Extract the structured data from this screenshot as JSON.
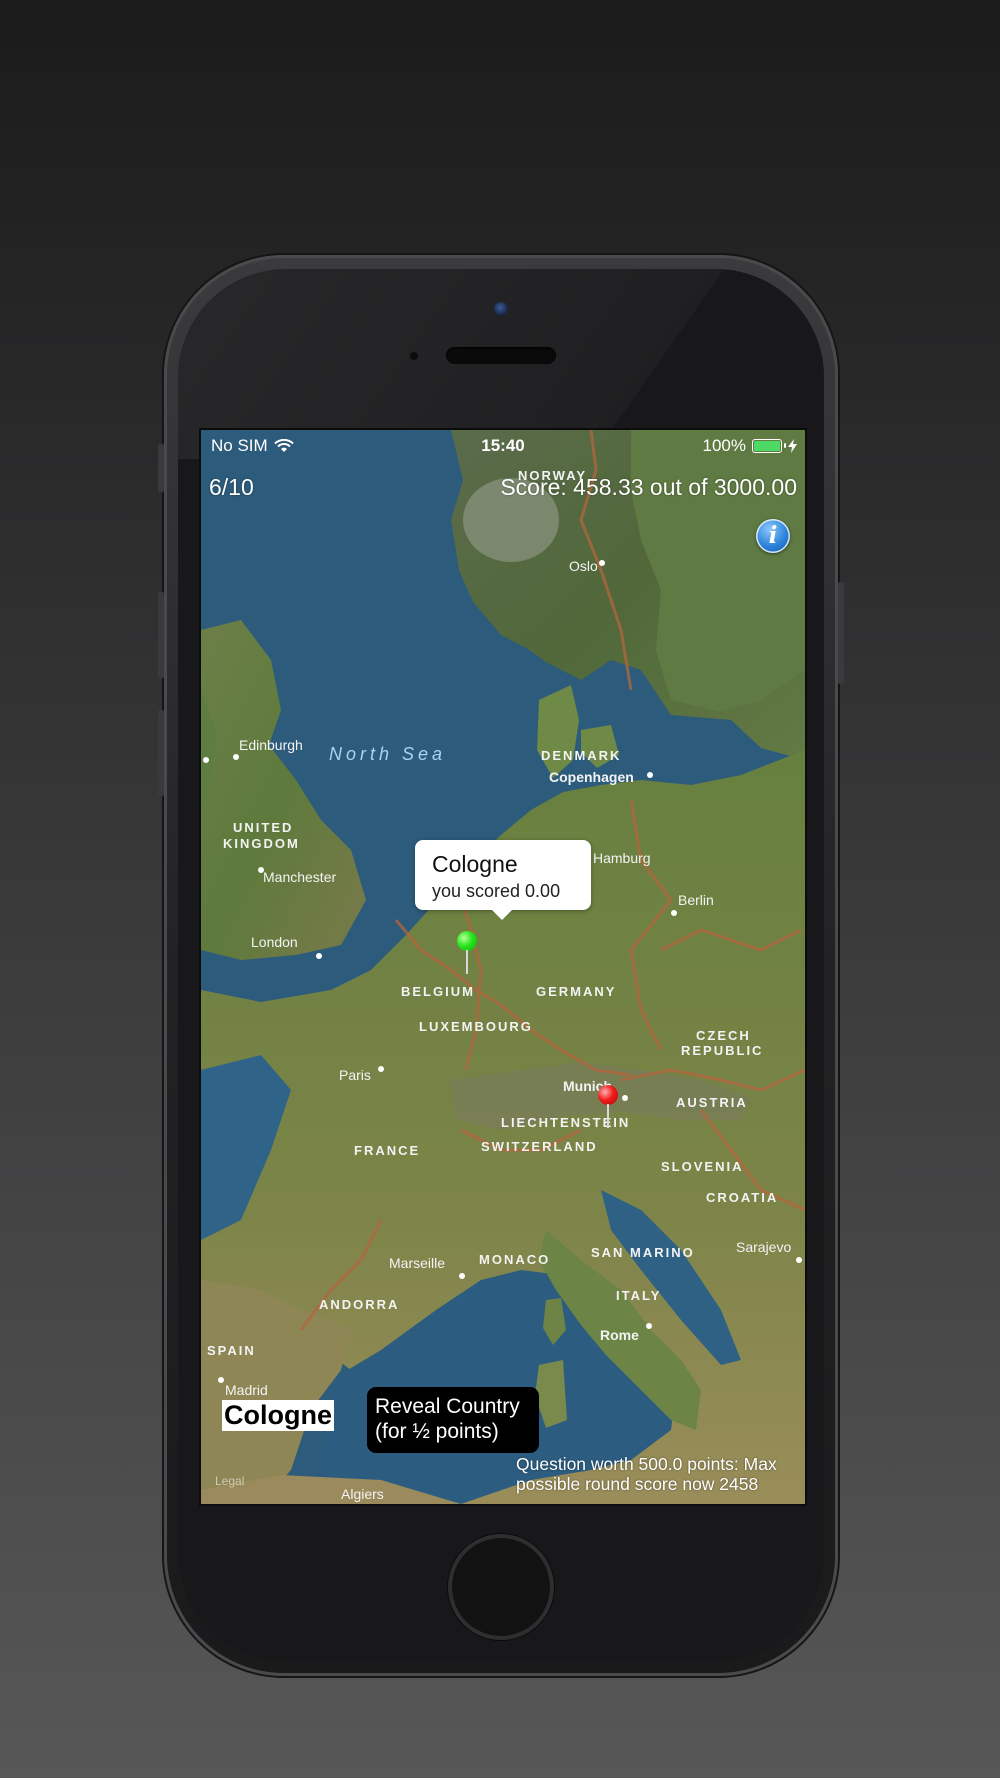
{
  "status_bar": {
    "carrier": "No SIM",
    "time": "15:40",
    "battery_percent": "100%",
    "battery_level": 1.0
  },
  "header": {
    "progress": "6/10",
    "score": "Score: 458.33 out of 3000.00"
  },
  "callout": {
    "title": "Cologne",
    "subtitle": "you scored 0.00"
  },
  "target_city": "Cologne",
  "reveal_button": {
    "line1": "Reveal Country",
    "line2": "(for ½ points)"
  },
  "note": "Question worth 500.0 points: Max possible round score now 2458",
  "legal": "Legal",
  "map_labels": {
    "countries": {
      "norway": "NORWAY",
      "denmark": "DENMARK",
      "uk1": "UNITED",
      "uk2": "KINGDOM",
      "belgium": "BELGIUM",
      "germany": "GERMANY",
      "luxembourg": "LUXEMBOURG",
      "czech1": "CZECH",
      "czech2": "REPUBLIC",
      "austria": "AUSTRIA",
      "liechtenstein": "LIECHTENSTEIN",
      "switzerland": "SWITZERLAND",
      "france": "FRANCE",
      "slovenia": "SLOVENIA",
      "croatia": "CROATIA",
      "monaco": "MONACO",
      "san_marino": "SAN MARINO",
      "andorra": "ANDORRA",
      "italy": "ITALY",
      "spain": "SPAIN"
    },
    "cities": {
      "oslo": "Oslo",
      "edinburgh": "Edinburgh",
      "copenhagen": "Copenhagen",
      "manchester": "Manchester",
      "hamburg": "Hamburg",
      "berlin": "Berlin",
      "london": "London",
      "paris": "Paris",
      "munich": "Munich",
      "marseille": "Marseille",
      "sarajevo": "Sarajevo",
      "rome": "Rome",
      "madrid": "Madrid",
      "algiers": "Algiers"
    },
    "seas": {
      "north_sea": "North Sea"
    }
  },
  "colors": {
    "callout_bg": "#ffffff",
    "reveal_bg": "#000000",
    "guess_pin": "#27e61a",
    "answer_pin": "#f21a1a"
  }
}
